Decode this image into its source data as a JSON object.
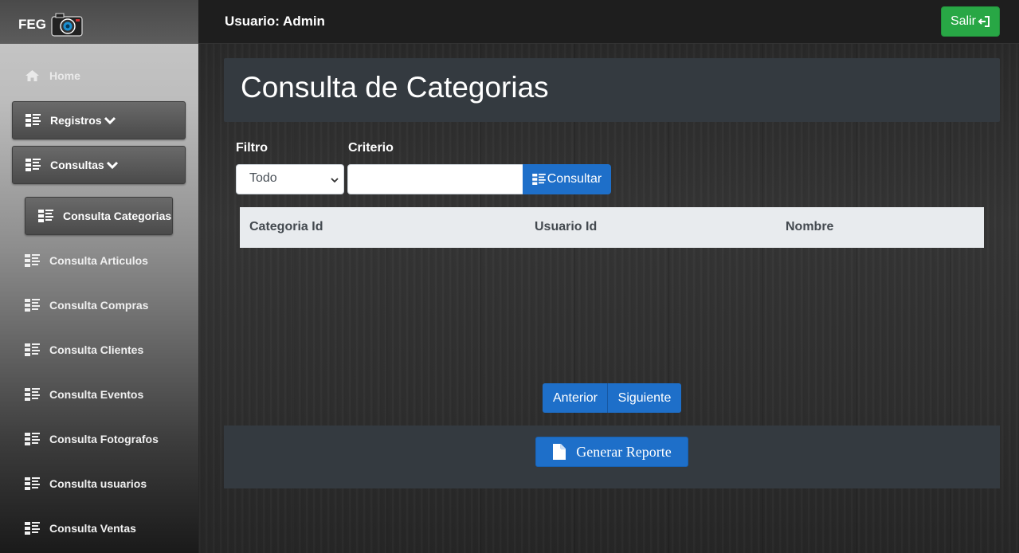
{
  "brand": {
    "name": "FEG",
    "logo_icon": "camera-icon"
  },
  "header": {
    "user_label": "Usuario: Admin",
    "logout_label": "Salir",
    "logout_icon": "logout-icon"
  },
  "sidebar": {
    "home": "Home",
    "registros": "Registros",
    "consultas": "Consultas",
    "items": [
      "Consulta Categorias",
      "Consulta Articulos",
      "Consulta Compras",
      "Consulta Clientes",
      "Consulta Eventos",
      "Consulta Fotografos",
      "Consulta usuarios",
      "Consulta Ventas"
    ],
    "active_item": "Consulta Categorias"
  },
  "main": {
    "title": "Consulta de Categorias",
    "filter_label": "Filtro",
    "filter_value": "Todo",
    "criteria_label": "Criterio",
    "criteria_value": "",
    "query_button": "Consultar",
    "table": {
      "columns": [
        "Categoria Id",
        "Usuario Id",
        "Nombre"
      ],
      "rows": []
    },
    "pagination": {
      "prev": "Anterior",
      "next": "Siguiente"
    },
    "report_button": "Generar Reporte"
  },
  "colors": {
    "primary": "#1e6fc9",
    "success": "#28a745",
    "panel": "#343a40",
    "table_head": "#e8ebee"
  }
}
